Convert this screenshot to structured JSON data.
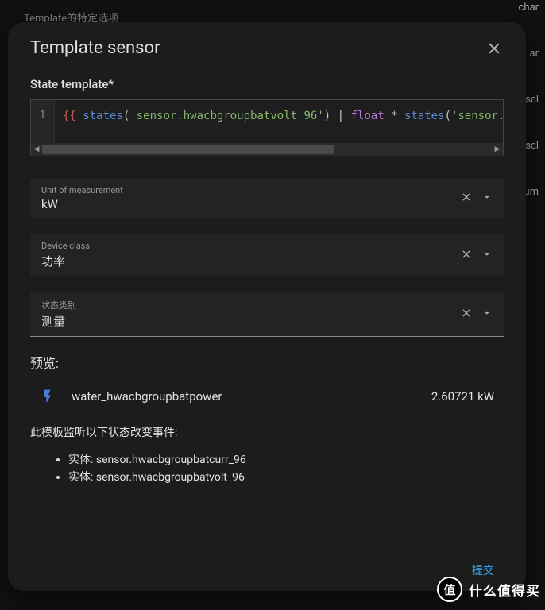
{
  "backdrop": {
    "option_text": "Template的特定选项",
    "right_items": [
      "char",
      "ar",
      "scl",
      "scl",
      "um"
    ]
  },
  "dialog": {
    "title": "Template sensor",
    "state_template_label": "State template*",
    "code_line_number": "1",
    "code_tokens": {
      "brace_open": "{{",
      "states_fn": "states",
      "paren_open": "(",
      "sensor1": "'sensor.hwacbgroupbatvolt_96'",
      "paren_close": ")",
      "pipe": " | ",
      "float_kw": "float",
      "mul": " * ",
      "states_fn2": "states",
      "paren_open2": "(",
      "sensor2_partial": "'sensor.hw"
    },
    "unit": {
      "label": "Unit of measurement",
      "value": "kW"
    },
    "device_class": {
      "label": "Device class",
      "value": "功率"
    },
    "state_class": {
      "label": "状态类别",
      "value": "测量"
    },
    "preview": {
      "label": "预览:",
      "name": "water_hwacbgroupbatpower",
      "value": "2.60721 kW"
    },
    "listen_text": "此模板监听以下状态改变事件:",
    "entity_prefix": "实体: ",
    "entities": [
      "sensor.hwacbgroupbatcurr_96",
      "sensor.hwacbgroupbatvolt_96"
    ],
    "submit": "提交"
  },
  "watermark": {
    "badge": "值",
    "text": "什么值得买"
  }
}
